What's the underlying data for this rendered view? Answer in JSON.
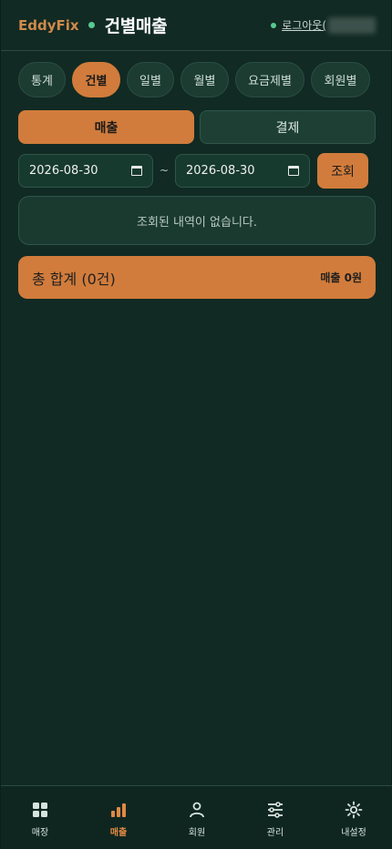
{
  "header": {
    "brand": "EddyFix",
    "page_title": "건별매출",
    "logout_label": "로그아웃("
  },
  "tabs": [
    {
      "label": "통계"
    },
    {
      "label": "건별"
    },
    {
      "label": "일별"
    },
    {
      "label": "월별"
    },
    {
      "label": "요금제별"
    },
    {
      "label": "회원별"
    }
  ],
  "segment": {
    "sales_label": "매출",
    "payment_label": "결제"
  },
  "filters": {
    "start_date": "2026-08-30",
    "end_date": "2026-08-30",
    "separator": "~",
    "query_label": "조회"
  },
  "result": {
    "empty_message": "조회된 내역이 없습니다."
  },
  "summary": {
    "total_label": "총 합계 (0건)",
    "sales_total": "매출 0원"
  },
  "bottom_nav": [
    {
      "label": "매장",
      "icon": "grid-icon"
    },
    {
      "label": "매출",
      "icon": "bar-chart-icon"
    },
    {
      "label": "회원",
      "icon": "user-icon"
    },
    {
      "label": "관리",
      "icon": "sliders-icon"
    },
    {
      "label": "내설정",
      "icon": "gear-icon"
    }
  ],
  "colors": {
    "background": "#112a23",
    "accent": "#d17c3c",
    "status_dot": "#58c98f"
  }
}
